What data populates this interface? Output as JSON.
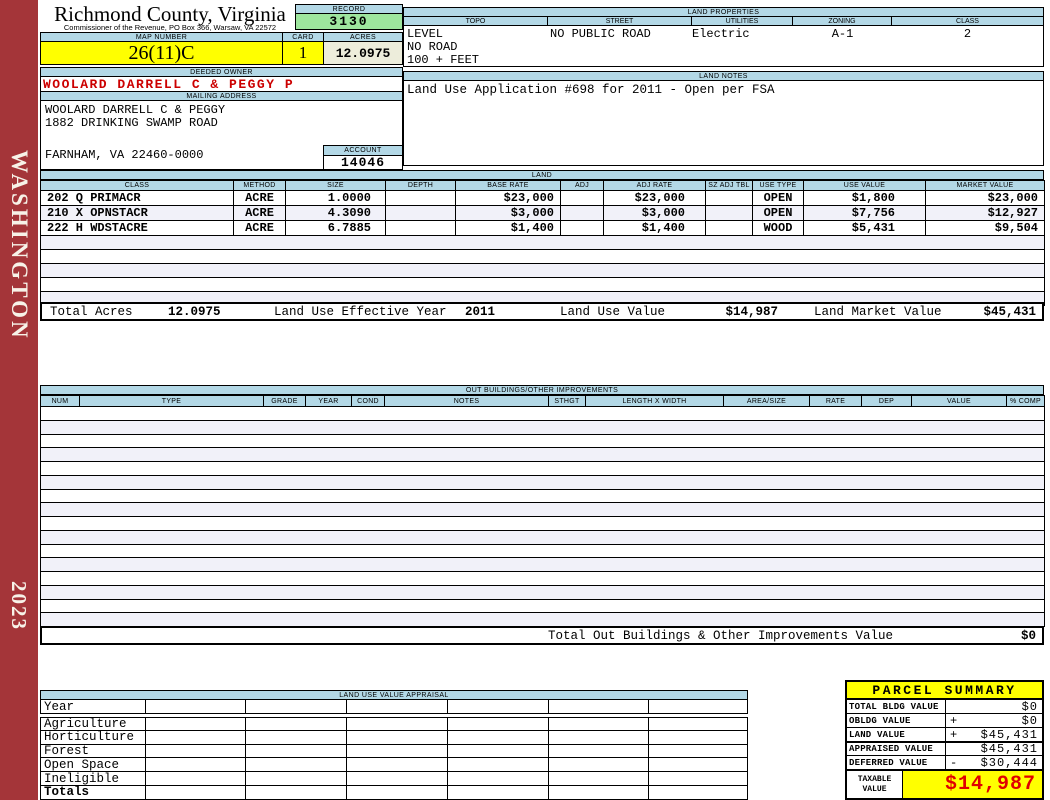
{
  "sidebar": {
    "county": "WASHINGTON",
    "year": "2023"
  },
  "header": {
    "county_title": "Richmond County, Virginia",
    "county_subtitle": "Commissioner of the Revenue, PO Box 366, Warsaw, VA 22572",
    "record_label": "RECORD",
    "record_value": "3130",
    "map_number_label": "MAP NUMBER",
    "map_number_value": "26(11)C",
    "card_label": "CARD",
    "card_value": "1",
    "acres_label": "ACRES",
    "acres_value": "12.0975",
    "deeded_owner_label": "DEEDED OWNER",
    "deeded_owner_value": "WOOLARD DARRELL C & PEGGY P",
    "mailing_address_label": "MAILING ADDRESS",
    "mailing_line1": "WOOLARD DARRELL C & PEGGY",
    "mailing_line2": "1882 DRINKING SWAMP ROAD",
    "mailing_line3": "FARNHAM, VA 22460-0000",
    "account_label": "ACCOUNT",
    "account_value": "14046"
  },
  "land_properties": {
    "title": "LAND PROPERTIES",
    "col_topo": "TOPO",
    "col_street": "STREET",
    "col_utilities": "UTILITIES",
    "col_zoning": "ZONING",
    "col_class": "CLASS",
    "topo_line1": "LEVEL",
    "topo_line2": "NO ROAD",
    "topo_line3": "100 + FEET",
    "street_value": "NO PUBLIC ROAD",
    "utilities_value": "Electric",
    "zoning_value": "A-1",
    "class_value": "2"
  },
  "land_notes": {
    "title": "LAND NOTES",
    "text": "Land Use Application #698 for 2011 - Open per FSA"
  },
  "land_table": {
    "title": "LAND",
    "columns": [
      "CLASS",
      "METHOD",
      "SIZE",
      "DEPTH",
      "BASE RATE",
      "ADJ",
      "ADJ RATE",
      "SZ ADJ TBL",
      "USE TYPE",
      "USE VALUE",
      "MARKET VALUE"
    ],
    "rows": [
      [
        "202 Q PRIMACR",
        "ACRE",
        "1.0000",
        "",
        "$23,000",
        "",
        "$23,000",
        "",
        "OPEN",
        "$1,800",
        "$23,000"
      ],
      [
        "210 X OPNSTACR",
        "ACRE",
        "4.3090",
        "",
        "$3,000",
        "",
        "$3,000",
        "",
        "OPEN",
        "$7,756",
        "$12,927"
      ],
      [
        "222 H WDSTACRE",
        "ACRE",
        "6.7885",
        "",
        "$1,400",
        "",
        "$1,400",
        "",
        "WOOD",
        "$5,431",
        "$9,504"
      ]
    ],
    "empty_row_count": 5,
    "totals": {
      "total_acres_label": "Total Acres",
      "total_acres": "12.0975",
      "effective_year_label": "Land Use Effective Year",
      "effective_year": "2011",
      "use_value_label": "Land Use Value",
      "use_value": "$14,987",
      "market_value_label": "Land Market Value",
      "market_value": "$45,431"
    }
  },
  "out_buildings": {
    "title": "OUT BUILDINGS/OTHER IMPROVEMENTS",
    "columns": [
      "NUM",
      "TYPE",
      "GRADE",
      "YEAR",
      "COND",
      "NOTES",
      "STHGT",
      "LENGTH X WIDTH",
      "AREA/SIZE",
      "RATE",
      "DEP",
      "VALUE",
      "% COMP"
    ],
    "empty_row_count": 16,
    "total_label": "Total Out Buildings & Other Improvements Value",
    "total_value": "$0"
  },
  "land_use_appraisal": {
    "title": "LAND USE VALUE APPRAISAL",
    "row_labels": [
      "Year",
      "Agriculture",
      "Horticulture",
      "Forest",
      "Open Space",
      "Ineligible",
      "Totals"
    ],
    "data_column_count": 6
  },
  "parcel_summary": {
    "title": "PARCEL SUMMARY",
    "rows": [
      {
        "label": "TOTAL BLDG VALUE",
        "op": "",
        "value": "$0"
      },
      {
        "label": "OBLDG VALUE",
        "op": "+",
        "value": "$0"
      },
      {
        "label": "LAND VALUE",
        "op": "+",
        "value": "$45,431"
      },
      {
        "label": "APPRAISED VALUE",
        "op": "",
        "value": "$45,431"
      },
      {
        "label": "DEFERRED VALUE",
        "op": "-",
        "value": "$30,444"
      }
    ],
    "taxable_label_line1": "TAXABLE",
    "taxable_label_line2": "VALUE",
    "taxable_value": "$14,987"
  },
  "colors": {
    "header_blue": "#B3D8E6",
    "record_green": "#9EE69E",
    "highlight_yellow": "#FFFF00",
    "acres_beige": "#EDEDDB",
    "owner_red": "#CC0000",
    "taxable_red": "#E00000",
    "sidebar_red": "#A43539",
    "alt_row": "#F1F1F9"
  }
}
